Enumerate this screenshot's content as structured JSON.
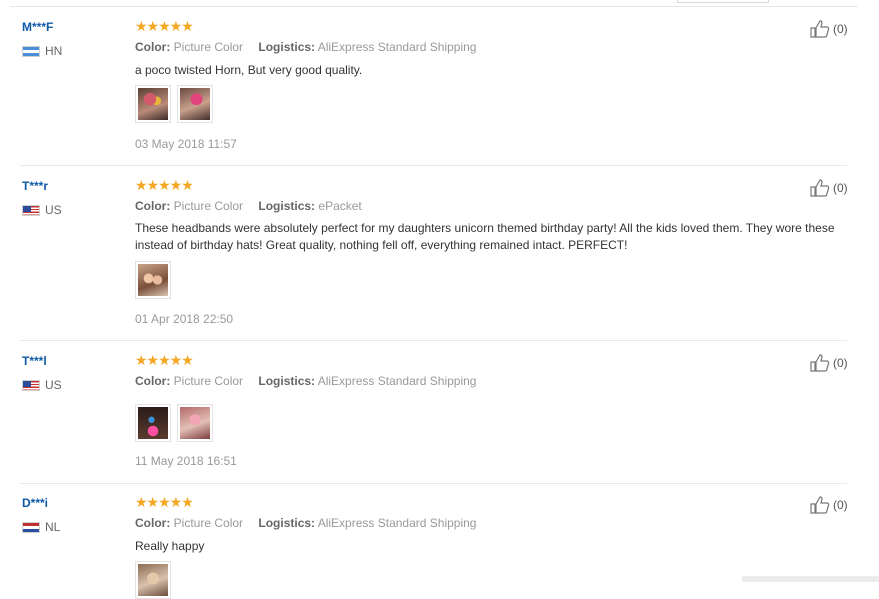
{
  "labels": {
    "color": "Color:",
    "logistics": "Logistics:"
  },
  "reviews": [
    {
      "user": "M***F",
      "country": "HN",
      "flag": "flag-hn",
      "stars": "★★★★★",
      "color_value": "Picture Color",
      "logistics_value": "AliExpress Standard Shipping",
      "text": "a poco twisted Horn, But very good quality.",
      "photos": [
        "p1",
        "p2"
      ],
      "date": "03 May 2018 11:57",
      "helpful": "(0)"
    },
    {
      "user": "T***r",
      "country": "US",
      "flag": "flag-us",
      "stars": "★★★★★",
      "color_value": "Picture Color",
      "logistics_value": "ePacket",
      "text": "These headbands were absolutely perfect for my daughters unicorn themed birthday party! All the kids loved them. They wore these instead of birthday hats! Great quality, nothing fell off, everything remained intact. PERFECT!",
      "photos": [
        "p3"
      ],
      "date": "01 Apr 2018 22:50",
      "helpful": "(0)"
    },
    {
      "user": "T***l",
      "country": "US",
      "flag": "flag-us",
      "stars": "★★★★★",
      "color_value": "Picture Color",
      "logistics_value": "AliExpress Standard Shipping",
      "text": "",
      "photos": [
        "p4",
        "p5"
      ],
      "date": "11 May 2018 16:51",
      "helpful": "(0)"
    },
    {
      "user": "D***i",
      "country": "NL",
      "flag": "flag-nl",
      "stars": "★★★★★",
      "color_value": "Picture Color",
      "logistics_value": "AliExpress Standard Shipping",
      "text": "Really happy",
      "photos": [
        "p6"
      ],
      "date": "",
      "helpful": "(0)"
    }
  ]
}
